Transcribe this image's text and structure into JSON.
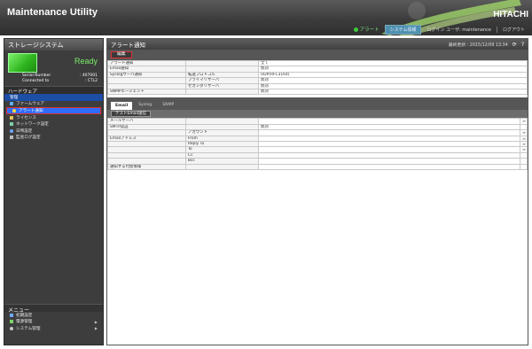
{
  "header": {
    "app_title": "Maintenance Utility",
    "brand": "HITACHI",
    "alert_label": "アラート",
    "system_button": "システム情報",
    "user_text": "ログイン ユーザ: maintenance",
    "logout_label": "ログアウト"
  },
  "sidebar": {
    "title": "ストレージシステム",
    "status": "Ready",
    "serial_label": "Serial Number",
    "serial_value": ": 407001",
    "connected_label": "Connected to",
    "connected_value": ": CTL2",
    "hardware_section": "ハードウェア",
    "items": [
      {
        "label": "管理"
      },
      {
        "label": "ファームウェア"
      },
      {
        "label": "アラート通知"
      },
      {
        "label": "ライセンス"
      },
      {
        "label": "ネットワーク設定"
      },
      {
        "label": "日時設定"
      },
      {
        "label": "監査ログ設定"
      }
    ],
    "menu_title": "メニュー",
    "menu_items": [
      {
        "label": "初期設定"
      },
      {
        "label": "電源管理"
      },
      {
        "label": "システム管理"
      }
    ]
  },
  "main": {
    "title": "アラート通知",
    "last_update": "最終更新 : 2015/12/09 13:34",
    "edit_button": "編集",
    "settings": [
      {
        "label": "アラート通知",
        "sub": "",
        "value": "全て"
      },
      {
        "label": "Email通知",
        "sub": "",
        "value": "無効"
      },
      {
        "label": "Syslogサーバ通知",
        "sub": "転送プロトコル",
        "value": "UDP(RFC3164)"
      },
      {
        "label": "",
        "sub": "プライマリサーバ",
        "value": "無効"
      },
      {
        "label": "",
        "sub": "セカンダリサーバ",
        "value": "無効"
      },
      {
        "label": "SNMPエージェント",
        "sub": "",
        "value": "無効"
      }
    ],
    "tabs": [
      {
        "label": "Email"
      },
      {
        "label": "Syslog"
      },
      {
        "label": "SNMP"
      }
    ],
    "test_button": "テストEmail送信",
    "email_rows": [
      {
        "label": "メールサーバ",
        "sub": "",
        "value": ""
      },
      {
        "label": "SMTP認証",
        "sub": "",
        "value": "無効"
      },
      {
        "label": "",
        "sub": "アカウント",
        "value": ""
      },
      {
        "label": "Emailアドレス",
        "sub": "From",
        "value": ""
      },
      {
        "label": "",
        "sub": "Reply To",
        "value": ""
      },
      {
        "label": "",
        "sub": "To",
        "value": ""
      },
      {
        "label": "",
        "sub": "Cc",
        "value": ""
      },
      {
        "label": "",
        "sub": "Bcc",
        "value": ""
      },
      {
        "label": "通知する付加情報",
        "sub": "",
        "value": ""
      }
    ]
  },
  "colors": {
    "accent": "#2f6dff",
    "ready": "#7cf06a",
    "highlight_border": "#e03030"
  }
}
